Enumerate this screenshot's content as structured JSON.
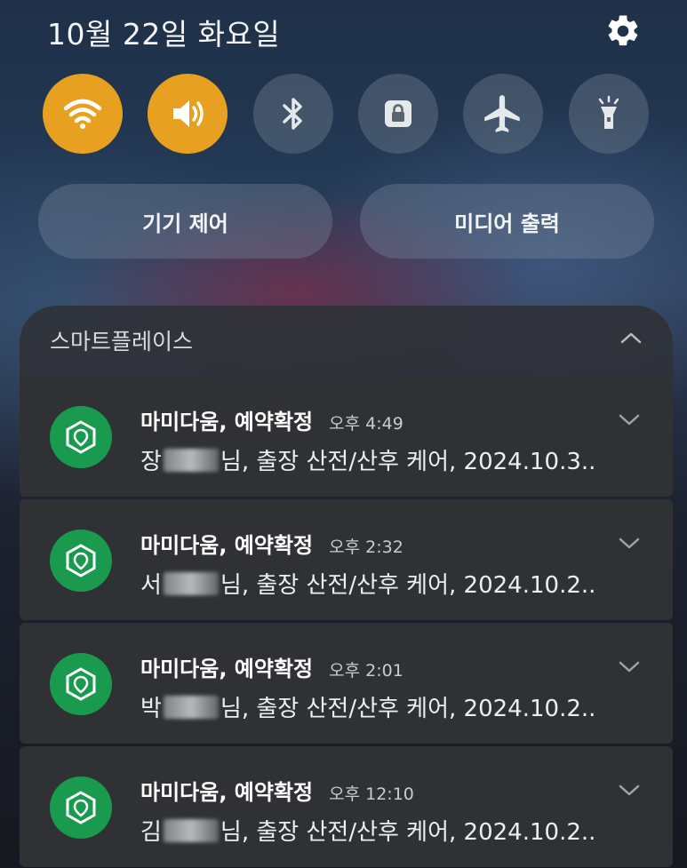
{
  "status": {
    "date": "10월 22일 화요일"
  },
  "quick_settings": {
    "toggles": [
      {
        "name": "wifi",
        "icon": "wifi-icon",
        "on": true
      },
      {
        "name": "sound",
        "icon": "sound-icon",
        "on": true
      },
      {
        "name": "bluetooth",
        "icon": "bluetooth-icon",
        "on": false
      },
      {
        "name": "screen-lock",
        "icon": "lock-rotation-icon",
        "on": false
      },
      {
        "name": "airplane",
        "icon": "airplane-icon",
        "on": false
      },
      {
        "name": "flashlight",
        "icon": "flashlight-icon",
        "on": false
      }
    ],
    "device_control_label": "기기 제어",
    "media_output_label": "미디어 출력"
  },
  "notifications": {
    "group_title": "스마트플레이스",
    "items": [
      {
        "title": "마미다움, 예약확정",
        "time": "오후 4:49",
        "body_prefix": "장",
        "body_suffix": "님, 출장 산전/산후 케어, 2024.10.3.."
      },
      {
        "title": "마미다움, 예약확정",
        "time": "오후 2:32",
        "body_prefix": "서",
        "body_suffix": "님, 출장 산전/산후 케어, 2024.10.2.."
      },
      {
        "title": "마미다움, 예약확정",
        "time": "오후 2:01",
        "body_prefix": "박",
        "body_suffix": "님, 출장 산전/산후 케어, 2024.10.2.."
      },
      {
        "title": "마미다움, 예약확정",
        "time": "오후 12:10",
        "body_prefix": "김",
        "body_suffix": "님, 출장 산전/산후 케어, 2024.10.2.."
      }
    ]
  },
  "colors": {
    "accent_on": "#e8a020",
    "app_icon": "#1a9a4e",
    "card_bg": "#2f3135"
  }
}
